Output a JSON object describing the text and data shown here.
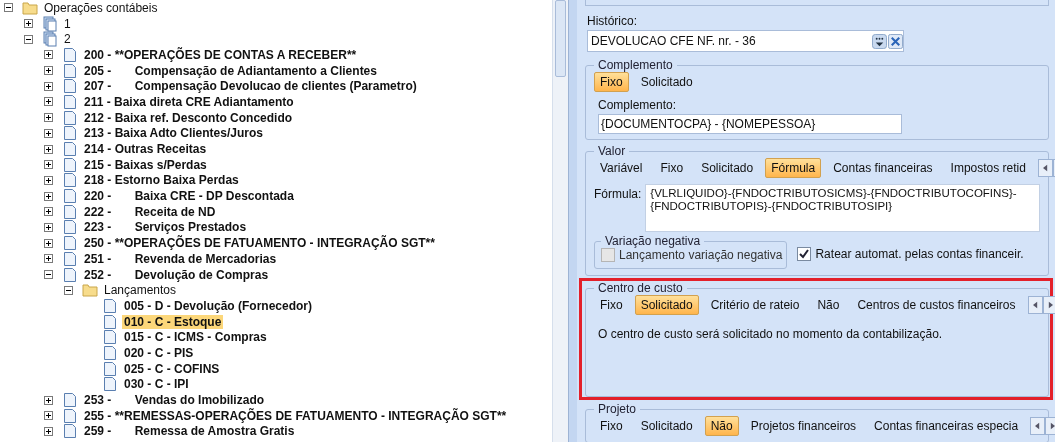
{
  "tree": [
    {
      "label": "Operações contábeis",
      "kind": "folder",
      "expanded": true,
      "selected": false,
      "children": [
        {
          "label": "1",
          "kind": "stack",
          "expanded": false,
          "selected": false
        },
        {
          "label": "2",
          "kind": "stack",
          "expanded": true,
          "selected": false,
          "children": [
            {
              "label": "200 - **OPERAÇÕES DE CONTAS A RECEBER**",
              "kind": "doc",
              "expanded": false,
              "selected": false
            },
            {
              "label": "205 -       Compensação de Adiantamento a Clientes",
              "kind": "doc",
              "expanded": false,
              "selected": false
            },
            {
              "label": "207 -       Compensação Devolucao de clientes (Parametro)",
              "kind": "doc",
              "expanded": false,
              "selected": false
            },
            {
              "label": "211 - Baixa direta CRE Adiantamento",
              "kind": "doc",
              "expanded": false,
              "selected": false
            },
            {
              "label": "212 - Baixa ref. Desconto Concedido",
              "kind": "doc",
              "expanded": false,
              "selected": false
            },
            {
              "label": "213 - Baixa Adto Clientes/Juros",
              "kind": "doc",
              "expanded": false,
              "selected": false
            },
            {
              "label": "214 - Outras Receitas",
              "kind": "doc",
              "expanded": false,
              "selected": false
            },
            {
              "label": "215 - Baixas s/Perdas",
              "kind": "doc",
              "expanded": false,
              "selected": false
            },
            {
              "label": "218 - Estorno Baixa Perdas",
              "kind": "doc",
              "expanded": false,
              "selected": false
            },
            {
              "label": "220 -       Baixa CRE - DP Descontada",
              "kind": "doc",
              "expanded": false,
              "selected": false
            },
            {
              "label": "222 -       Receita de ND",
              "kind": "doc",
              "expanded": false,
              "selected": false
            },
            {
              "label": "223 -       Serviços Prestados",
              "kind": "doc",
              "expanded": false,
              "selected": false
            },
            {
              "label": "250 - **OPERAÇÕES DE FATUAMENTO - INTEGRAÇÃO SGT**",
              "kind": "doc",
              "expanded": false,
              "selected": false
            },
            {
              "label": "251 -       Revenda de Mercadorias",
              "kind": "doc",
              "expanded": false,
              "selected": false
            },
            {
              "label": "252 -       Devolução de Compras",
              "kind": "doc",
              "expanded": true,
              "selected": false,
              "children": [
                {
                  "label": "Lançamentos",
                  "kind": "folder",
                  "expanded": true,
                  "selected": false,
                  "children": [
                    {
                      "label": "005 - D - Devolução (Fornecedor)",
                      "kind": "doc",
                      "selected": false
                    },
                    {
                      "label": "010 - C - Estoque",
                      "kind": "doc",
                      "selected": true
                    },
                    {
                      "label": "015 - C - ICMS - Compras",
                      "kind": "doc",
                      "selected": false
                    },
                    {
                      "label": "020 - C - PIS",
                      "kind": "doc",
                      "selected": false
                    },
                    {
                      "label": "025 - C - COFINS",
                      "kind": "doc",
                      "selected": false
                    },
                    {
                      "label": "030 - C - IPI",
                      "kind": "doc",
                      "selected": false
                    }
                  ]
                }
              ]
            },
            {
              "label": "253 -       Vendas do Imobilizado",
              "kind": "doc",
              "expanded": false,
              "selected": false
            },
            {
              "label": "255 - **REMESSAS-OPERAÇÕES DE FATUAMENTO - INTEGRAÇÃO SGT**",
              "kind": "doc",
              "expanded": false,
              "selected": false
            },
            {
              "label": "259 -       Remessa de Amostra Gratis",
              "kind": "doc",
              "expanded": false,
              "selected": false
            }
          ]
        }
      ]
    }
  ],
  "historico": {
    "label": "Histórico:",
    "value": "DEVOLUCAO CFE NF. nr. - 36"
  },
  "complemento": {
    "title": "Complemento",
    "options": [
      {
        "label": "Fixo",
        "selected": true
      },
      {
        "label": "Solicitado",
        "selected": false
      }
    ],
    "field_label": "Complemento:",
    "value": "{DOCUMENTOCPA} - {NOMEPESSOA}"
  },
  "valor": {
    "title": "Valor",
    "options": [
      {
        "label": "Variável",
        "selected": false
      },
      {
        "label": "Fixo",
        "selected": false
      },
      {
        "label": "Solicitado",
        "selected": false
      },
      {
        "label": "Fórmula",
        "selected": true
      },
      {
        "label": "Contas financeiras",
        "selected": false
      },
      {
        "label": "Impostos retid",
        "selected": false
      }
    ],
    "formula_label": "Fórmula:",
    "formula": "{VLRLIQUIDO}-{FNDOCTRIBUTOSICMS}-{FNDOCTRIBUTOCOFINS}-{FNDOCTRIBUTOPIS}-{FNDOCTRIBUTOSIPI}",
    "variacao": {
      "title": "Variação negativa",
      "label": "Lançamento variação negativa",
      "checked": false,
      "disabled": true
    },
    "ratear": {
      "label": "Ratear automat. pelas contas financeir.",
      "checked": true
    }
  },
  "centro_custo": {
    "title": "Centro de custo",
    "highlighted": true,
    "options": [
      {
        "label": "Fixo",
        "selected": false
      },
      {
        "label": "Solicitado",
        "selected": true
      },
      {
        "label": "Critério de rateio",
        "selected": false
      },
      {
        "label": "Não",
        "selected": false
      },
      {
        "label": "Centros de custos financeiros",
        "selected": false
      }
    ],
    "message": "O centro de custo será solicitado no momento da contabilização."
  },
  "projeto": {
    "title": "Projeto",
    "options": [
      {
        "label": "Fixo",
        "selected": false
      },
      {
        "label": "Solicitado",
        "selected": false
      },
      {
        "label": "Não",
        "selected": true
      },
      {
        "label": "Projetos financeiros",
        "selected": false
      },
      {
        "label": "Contas financeiras especia",
        "selected": false
      }
    ]
  }
}
